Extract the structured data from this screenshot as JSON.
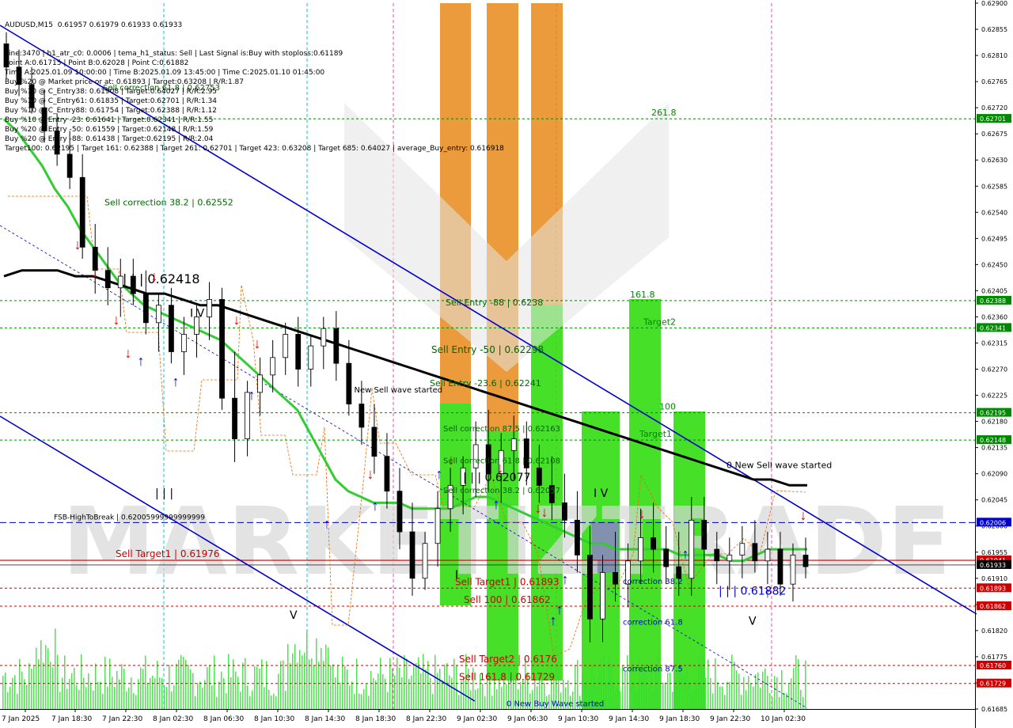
{
  "header": {
    "symbol": "AUDUSD,M15",
    "ohlc": "0.61957 0.61979 0.61933 0.61933",
    "lines": [
      "Line:3470 | h1_atr_c0: 0.0006 | tema_h1_status: Sell | Last Signal is:Buy with stoploss:0.61189",
      "Point A:0.61715 | Point B:0.62028 | Point C:0.61882",
      "Time A:2025.01.09 10:00:00 | Time B:2025.01.09 13:45:00 | Time C:2025.01.10 01:45:00",
      "Buy %20 @ Market price or at: 0.61893 | Target:0.63208 | R/R:1.87",
      "Buy %10 @ C_Entry38: 0.61908 | Target:0.64027 | R/R:2.95",
      "Buy %10 @ C_Entry61: 0.61835 | Target:0.62701 | R/R:1.34",
      "Buy %10 @ C_Entry88: 0.61754 | Target:0.62388 | R/R:1.12",
      "Buy %10 @ Entry -23: 0.61641 | Target:0.62341 | R/R:1.55",
      "Buy %20 @ Entry -50: 0.61559 | Target:0.62148 | R/R:1.59",
      "Buy %20 @ Entry -88: 0.61438 | Target:0.62195 | R/R:2.04",
      "Target100: 0.62195 | Target 161: 0.62388 | Target 261: 0.62701 | Target 423: 0.63208 | Target 685: 0.64027 | average_Buy_entry: 0.616918"
    ]
  },
  "colors": {
    "up_candle": "#000000",
    "down_candle": "#000000",
    "ma_fast": "#33cc33",
    "ma_slow": "#000000",
    "channel": "#0000cc",
    "green_zone": "#33dd11",
    "orange_zone": "#e88a1a",
    "level_green": "#008800",
    "level_red": "#cc0000",
    "fsb_line": "#0000aa",
    "volume": "#33dd33"
  },
  "chart_data": {
    "type": "candlestick",
    "ylim": [
      0.61685,
      0.629
    ],
    "y_ticks": [
      "0.62900",
      "0.62855",
      "0.62810",
      "0.62765",
      "0.62720",
      "0.62675",
      "0.62630",
      "0.62585",
      "0.62540",
      "0.62495",
      "0.62450",
      "0.62405",
      "0.62360",
      "0.62315",
      "0.62270",
      "0.62225",
      "0.62180",
      "0.62135",
      "0.62090",
      "0.62045",
      "0.62000",
      "0.61955",
      "0.61910",
      "0.61865",
      "0.61820",
      "0.61775",
      "0.61730",
      "0.61685"
    ],
    "x_ticks": [
      "7 Jan 2025",
      "7 Jan 18:30",
      "7 Jan 22:30",
      "8 Jan 02:30",
      "8 Jan 06:30",
      "8 Jan 10:30",
      "8 Jan 14:30",
      "8 Jan 18:30",
      "8 Jan 22:30",
      "9 Jan 02:30",
      "9 Jan 06:30",
      "9 Jan 10:30",
      "9 Jan 14:30",
      "9 Jan 18:30",
      "9 Jan 22:30",
      "10 Jan 02:30"
    ],
    "price_badges": [
      {
        "label": "0.62701",
        "value": 0.62701,
        "color": "#008800"
      },
      {
        "label": "0.62388",
        "value": 0.62388,
        "color": "#008800"
      },
      {
        "label": "0.62341",
        "value": 0.62341,
        "color": "#008800"
      },
      {
        "label": "0.62195",
        "value": 0.62195,
        "color": "#008800"
      },
      {
        "label": "0.62148",
        "value": 0.62148,
        "color": "#008800"
      },
      {
        "label": "0.62006",
        "value": 0.62006,
        "color": "#0000cc"
      },
      {
        "label": "0.61941",
        "value": 0.61941,
        "color": "#cc0000"
      },
      {
        "label": "0.61933",
        "value": 0.61933,
        "color": "#000000"
      },
      {
        "label": "0.61893",
        "value": 0.61893,
        "color": "#cc0000"
      },
      {
        "label": "0.61862",
        "value": 0.61862,
        "color": "#cc0000"
      },
      {
        "label": "0.61760",
        "value": 0.6176,
        "color": "#cc0000"
      },
      {
        "label": "0.61729",
        "value": 0.61729,
        "color": "#cc0000"
      }
    ],
    "candles": [
      [
        0.6283,
        0.6285,
        0.6277,
        0.6279
      ],
      [
        0.6279,
        0.6282,
        0.6274,
        0.6276
      ],
      [
        0.6276,
        0.6279,
        0.6271,
        0.6272
      ],
      [
        0.6272,
        0.6275,
        0.6266,
        0.6268
      ],
      [
        0.6268,
        0.6271,
        0.6262,
        0.6264
      ],
      [
        0.6264,
        0.6268,
        0.6258,
        0.626
      ],
      [
        0.626,
        0.6264,
        0.6246,
        0.6248
      ],
      [
        0.6248,
        0.6252,
        0.624,
        0.6244
      ],
      [
        0.6244,
        0.6248,
        0.6238,
        0.6241
      ],
      [
        0.6241,
        0.6246,
        0.6236,
        0.6243
      ],
      [
        0.6243,
        0.6246,
        0.6238,
        0.624
      ],
      [
        0.624,
        0.6244,
        0.6233,
        0.6235
      ],
      [
        0.6235,
        0.624,
        0.623,
        0.6238
      ],
      [
        0.6238,
        0.6241,
        0.6228,
        0.623
      ],
      [
        0.623,
        0.6236,
        0.6226,
        0.6233
      ],
      [
        0.6233,
        0.6238,
        0.6229,
        0.6236
      ],
      [
        0.6236,
        0.6242,
        0.6232,
        0.6239
      ],
      [
        0.6239,
        0.6241,
        0.622,
        0.6222
      ],
      [
        0.6222,
        0.623,
        0.6211,
        0.6215
      ],
      [
        0.6215,
        0.6225,
        0.6212,
        0.6223
      ],
      [
        0.6223,
        0.6229,
        0.6219,
        0.6226
      ],
      [
        0.6226,
        0.6232,
        0.6223,
        0.6229
      ],
      [
        0.6229,
        0.6235,
        0.6226,
        0.6233
      ],
      [
        0.6233,
        0.6236,
        0.6224,
        0.6227
      ],
      [
        0.6227,
        0.6233,
        0.6224,
        0.6231
      ],
      [
        0.6231,
        0.6236,
        0.6227,
        0.6234
      ],
      [
        0.6234,
        0.6237,
        0.6225,
        0.6228
      ],
      [
        0.6228,
        0.6232,
        0.6219,
        0.6221
      ],
      [
        0.6221,
        0.6225,
        0.6214,
        0.6217
      ],
      [
        0.6217,
        0.6221,
        0.6209,
        0.6212
      ],
      [
        0.6212,
        0.6216,
        0.6203,
        0.6206
      ],
      [
        0.6206,
        0.621,
        0.6196,
        0.6199
      ],
      [
        0.6199,
        0.6204,
        0.6188,
        0.6191
      ],
      [
        0.6191,
        0.6199,
        0.6189,
        0.6197
      ],
      [
        0.6197,
        0.6206,
        0.6193,
        0.6203
      ],
      [
        0.6203,
        0.621,
        0.6199,
        0.6207
      ],
      [
        0.6207,
        0.6212,
        0.6202,
        0.621
      ],
      [
        0.621,
        0.6218,
        0.6205,
        0.6214
      ],
      [
        0.6214,
        0.622,
        0.6206,
        0.6209
      ],
      [
        0.6209,
        0.6216,
        0.6204,
        0.6213
      ],
      [
        0.6213,
        0.6219,
        0.6208,
        0.6215
      ],
      [
        0.6215,
        0.6218,
        0.6207,
        0.621
      ],
      [
        0.621,
        0.6214,
        0.6204,
        0.6207
      ],
      [
        0.6207,
        0.6212,
        0.6201,
        0.6204
      ],
      [
        0.6204,
        0.6209,
        0.6198,
        0.6201
      ],
      [
        0.6201,
        0.6206,
        0.6192,
        0.6195
      ],
      [
        0.6195,
        0.62,
        0.618,
        0.6184
      ],
      [
        0.6184,
        0.6195,
        0.618,
        0.6192
      ],
      [
        0.6192,
        0.6199,
        0.6187,
        0.619
      ],
      [
        0.619,
        0.6197,
        0.6186,
        0.6194
      ],
      [
        0.6194,
        0.6203,
        0.619,
        0.6198
      ],
      [
        0.6198,
        0.6204,
        0.6192,
        0.6196
      ],
      [
        0.6196,
        0.62,
        0.619,
        0.6193
      ],
      [
        0.6193,
        0.6199,
        0.6188,
        0.6191
      ],
      [
        0.6191,
        0.6205,
        0.6188,
        0.6201
      ],
      [
        0.6201,
        0.6205,
        0.6193,
        0.6196
      ],
      [
        0.6196,
        0.6199,
        0.619,
        0.6194
      ],
      [
        0.6194,
        0.6198,
        0.6189,
        0.6195
      ],
      [
        0.6195,
        0.62,
        0.6191,
        0.6197
      ],
      [
        0.6197,
        0.6201,
        0.6192,
        0.6194
      ],
      [
        0.6194,
        0.6199,
        0.619,
        0.6196
      ],
      [
        0.6196,
        0.6199,
        0.6188,
        0.619
      ],
      [
        0.619,
        0.6197,
        0.6187,
        0.6195
      ],
      [
        0.6195,
        0.6198,
        0.6191,
        0.6193
      ]
    ],
    "ma_fast": [
      0.627,
      0.6268,
      0.6265,
      0.6262,
      0.6258,
      0.6255,
      0.6251,
      0.6248,
      0.6245,
      0.6242,
      0.624,
      0.6238,
      0.6237,
      0.6236,
      0.6235,
      0.6234,
      0.6233,
      0.6232,
      0.623,
      0.6228,
      0.6226,
      0.6224,
      0.6222,
      0.622,
      0.6216,
      0.6212,
      0.6208,
      0.6206,
      0.6205,
      0.6204,
      0.6204,
      0.6204,
      0.6203,
      0.6203,
      0.6203,
      0.6203,
      0.6204,
      0.6205,
      0.6205,
      0.6204,
      0.6203,
      0.6202,
      0.6201,
      0.62,
      0.6199,
      0.6198,
      0.6197,
      0.6197,
      0.6196,
      0.6196,
      0.6196,
      0.6196,
      0.6196,
      0.6195,
      0.6195,
      0.6195,
      0.6195,
      0.6194,
      0.6194,
      0.6195,
      0.6196,
      0.6196,
      0.6196,
      0.6196
    ],
    "ma_slow": [
      0.6243,
      0.6244,
      0.6244,
      0.6244,
      0.6243,
      0.6243,
      0.6242,
      0.6241,
      0.624,
      0.624,
      0.6239,
      0.6238,
      0.6238,
      0.6237,
      0.6236,
      0.6235,
      0.6234,
      0.6233,
      0.6232,
      0.6231,
      0.623,
      0.6229,
      0.6228,
      0.6227,
      0.6226,
      0.6225,
      0.6224,
      0.6223,
      0.6222,
      0.6221,
      0.622,
      0.6219,
      0.6218,
      0.6217,
      0.6216,
      0.6215,
      0.6214,
      0.6213,
      0.6212,
      0.6211,
      0.621,
      0.6209,
      0.6208,
      0.6208,
      0.6207,
      0.6207
    ],
    "horizontal_levels": [
      {
        "label": "261.8",
        "value": 0.62701,
        "color": "#008800"
      },
      {
        "label": "161.8",
        "value": 0.62388,
        "color": "#008800"
      },
      {
        "label": "Target2",
        "value": 0.62341,
        "color": "#008800"
      },
      {
        "label": "100",
        "value": 0.62195,
        "color": "#008800"
      },
      {
        "label": "Target1",
        "value": 0.62148,
        "color": "#008800"
      },
      {
        "label": "FSB-HighToBreak | 0.62005999999999999",
        "value": 0.62006,
        "color": "#0000aa"
      },
      {
        "label": "Sell Target1 | 0.61976",
        "value": 0.61941,
        "color": "#cc0000"
      },
      {
        "label": "Sell Target1 | 0.61893",
        "value": 0.61893,
        "color": "#cc0000"
      },
      {
        "label": "Sell 100 | 0.61862",
        "value": 0.61862,
        "color": "#cc0000"
      },
      {
        "label": "Sell Target2 | 0.6176",
        "value": 0.6176,
        "color": "#cc0000"
      },
      {
        "label": "Sell 161.8 | 0.61729",
        "value": 0.61729,
        "color": "#cc0000"
      }
    ],
    "annotations": [
      {
        "text": "Sell correction 38.2 | 0.62552",
        "price": 0.62552,
        "color": "#006600"
      },
      {
        "text": "| | | 0.62418",
        "price": 0.62418,
        "color": "#000000"
      },
      {
        "text": "I V",
        "price": 0.6236,
        "color": "#000000"
      },
      {
        "text": "0 New Sell wave started",
        "price": 0.6223,
        "color": "#000000"
      },
      {
        "text": "Sell Entry -88 | 0.6238",
        "price": 0.6238,
        "color": "#006600"
      },
      {
        "text": "Sell Entry -50 | 0.62298",
        "price": 0.62298,
        "color": "#006600"
      },
      {
        "text": "Sell Entry -23.6 | 0.62241",
        "price": 0.62241,
        "color": "#006600"
      },
      {
        "text": "Sell correction 87.5 | 0.62163",
        "price": 0.62163,
        "color": "#006600"
      },
      {
        "text": "| | | 0.62077",
        "price": 0.62077,
        "color": "#000000"
      },
      {
        "text": "Sell correction 61.8 | 0.62108",
        "price": 0.62108,
        "color": "#006600"
      },
      {
        "text": "Sell correction 38.2 | 0.62057",
        "price": 0.62057,
        "color": "#006600"
      },
      {
        "text": "I V",
        "price": 0.6205,
        "color": "#000000"
      },
      {
        "text": "0 New Sell wave started",
        "price": 0.621,
        "color": "#000000"
      },
      {
        "text": "correction 38.2",
        "price": 0.619,
        "color": "#0000cc"
      },
      {
        "text": "correction 61.8",
        "price": 0.6183,
        "color": "#0000cc"
      },
      {
        "text": "correction 87.5",
        "price": 0.6175,
        "color": "#0000cc"
      },
      {
        "text": "| | | 0.61882",
        "price": 0.61882,
        "color": "#0000cc"
      },
      {
        "text": "V",
        "price": 0.6183,
        "color": "#000000"
      },
      {
        "text": "| | |",
        "price": 0.6205,
        "color": "#000000"
      },
      {
        "text": "V",
        "price": 0.6184,
        "color": "#000000"
      },
      {
        "text": "I",
        "price": 0.6191,
        "color": "#000000"
      },
      {
        "text": "0 New Buy Wave started",
        "price": 0.6169,
        "color": "#0000cc"
      },
      {
        "text": "Sell correction 61.8 | 0.62753",
        "price": 0.6275,
        "color": "#006600"
      }
    ],
    "watermark": "MARKETIZTRADE"
  }
}
